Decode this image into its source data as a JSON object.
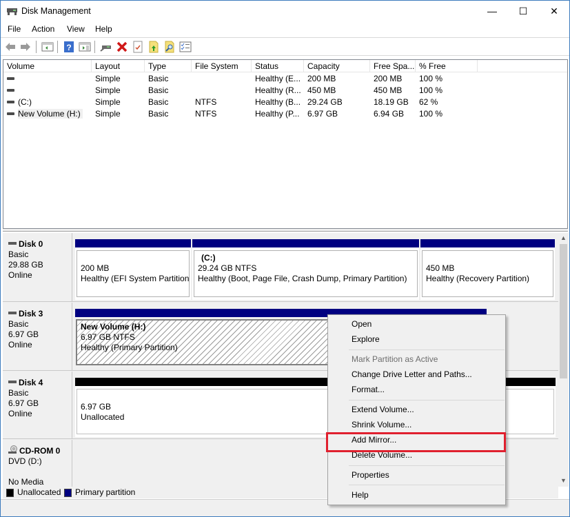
{
  "window": {
    "title": "Disk Management",
    "controls": {
      "minimize": "—",
      "maximize": "☐",
      "close": "✕"
    }
  },
  "menu": [
    "File",
    "Action",
    "View",
    "Help"
  ],
  "toolbar": {
    "icons": [
      "back-icon",
      "forward-icon",
      "show-hide-console-tree-icon",
      "help-icon",
      "show-hide-action-pane-icon",
      "connect-icon",
      "delete-icon",
      "properties-icon",
      "import-icon",
      "search-icon",
      "checklist-icon"
    ]
  },
  "volume_list": {
    "columns": [
      "Volume",
      "Layout",
      "Type",
      "File System",
      "Status",
      "Capacity",
      "Free Spa...",
      "% Free"
    ],
    "rows": [
      {
        "volume": "",
        "layout": "Simple",
        "type": "Basic",
        "fs": "",
        "status": "Healthy (E...",
        "capacity": "200 MB",
        "free": "200 MB",
        "pct": "100 %"
      },
      {
        "volume": "",
        "layout": "Simple",
        "type": "Basic",
        "fs": "",
        "status": "Healthy (R...",
        "capacity": "450 MB",
        "free": "450 MB",
        "pct": "100 %"
      },
      {
        "volume": "(C:)",
        "layout": "Simple",
        "type": "Basic",
        "fs": "NTFS",
        "status": "Healthy (B...",
        "capacity": "29.24 GB",
        "free": "18.19 GB",
        "pct": "62 %"
      },
      {
        "volume": "New Volume (H:)",
        "layout": "Simple",
        "type": "Basic",
        "fs": "NTFS",
        "status": "Healthy (P...",
        "capacity": "6.97 GB",
        "free": "6.94 GB",
        "pct": "100 %"
      }
    ]
  },
  "disks": [
    {
      "name": "Disk 0",
      "kind": "Basic",
      "size": "29.88 GB",
      "state": "Online",
      "partitions": [
        {
          "title": "",
          "size": "200 MB",
          "status": "Healthy (EFI System Partition)"
        },
        {
          "title": "(C:)",
          "size": "29.24 GB NTFS",
          "status": "Healthy (Boot, Page File, Crash Dump, Primary Partition)"
        },
        {
          "title": "",
          "size": "450 MB",
          "status": "Healthy (Recovery Partition)"
        }
      ]
    },
    {
      "name": "Disk 3",
      "kind": "Basic",
      "size": "6.97 GB",
      "state": "Online",
      "partitions": [
        {
          "title": "New Volume  (H:)",
          "size": "6.97 GB NTFS",
          "status": "Healthy (Primary Partition)"
        }
      ]
    },
    {
      "name": "Disk 4",
      "kind": "Basic",
      "size": "6.97 GB",
      "state": "Online",
      "partitions": [
        {
          "title": "",
          "size": "6.97 GB",
          "status": "Unallocated"
        }
      ]
    },
    {
      "name": "CD-ROM 0",
      "kind": "DVD (D:)",
      "size": "",
      "state": "No Media",
      "partitions": []
    }
  ],
  "legend": [
    {
      "label": "Unallocated",
      "color": "#000000"
    },
    {
      "label": "Primary partition",
      "color": "#000080"
    }
  ],
  "context_menu": {
    "items": [
      {
        "label": "Open",
        "disabled": false
      },
      {
        "label": "Explore",
        "disabled": false
      },
      {
        "label": "Mark Partition as Active",
        "disabled": true
      },
      {
        "label": "Change Drive Letter and Paths...",
        "disabled": false
      },
      {
        "label": "Format...",
        "disabled": false
      },
      {
        "label": "Extend Volume...",
        "disabled": false
      },
      {
        "label": "Shrink Volume...",
        "disabled": false
      },
      {
        "label": "Add Mirror...",
        "disabled": false,
        "highlighted": true
      },
      {
        "label": "Delete Volume...",
        "disabled": false
      },
      {
        "label": "Properties",
        "disabled": false
      },
      {
        "label": "Help",
        "disabled": false
      }
    ]
  },
  "colors": {
    "primary_partition": "#000080",
    "unallocated": "#000000",
    "highlight": "#e0202e"
  }
}
